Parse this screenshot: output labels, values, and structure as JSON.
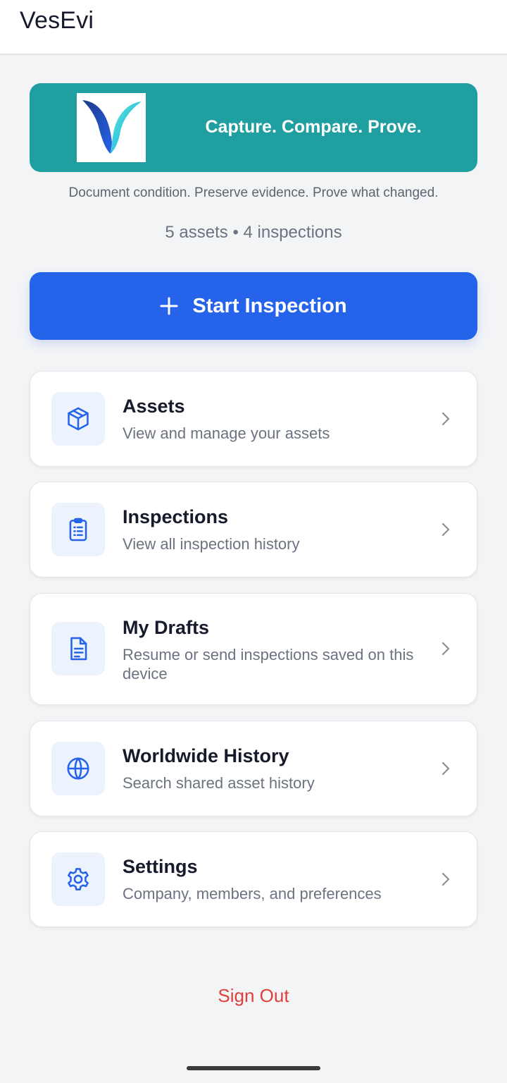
{
  "app": {
    "title": "VesEvi"
  },
  "banner": {
    "tagline": "Capture. Compare. Prove.",
    "logo": "vesevi-logo"
  },
  "subtitle": "Document condition. Preserve evidence. Prove what changed.",
  "stats": {
    "text": "5 assets • 4 inspections"
  },
  "primary_action": {
    "label": "Start Inspection",
    "icon": "plus-icon"
  },
  "menu": {
    "items": [
      {
        "title": "Assets",
        "description": "View and manage your assets",
        "icon": "cube-icon"
      },
      {
        "title": "Inspections",
        "description": "View all inspection history",
        "icon": "clipboard-icon"
      },
      {
        "title": "My Drafts",
        "description": "Resume or send inspections saved on this device",
        "icon": "document-icon"
      },
      {
        "title": "Worldwide History",
        "description": "Search shared asset history",
        "icon": "globe-icon"
      },
      {
        "title": "Settings",
        "description": "Company, members, and preferences",
        "icon": "gear-icon"
      }
    ]
  },
  "sign_out": {
    "label": "Sign Out"
  },
  "colors": {
    "accent": "#2563eb",
    "banner": "#1f9fa0",
    "danger": "#e0403d",
    "background": "#f3f4f6"
  }
}
